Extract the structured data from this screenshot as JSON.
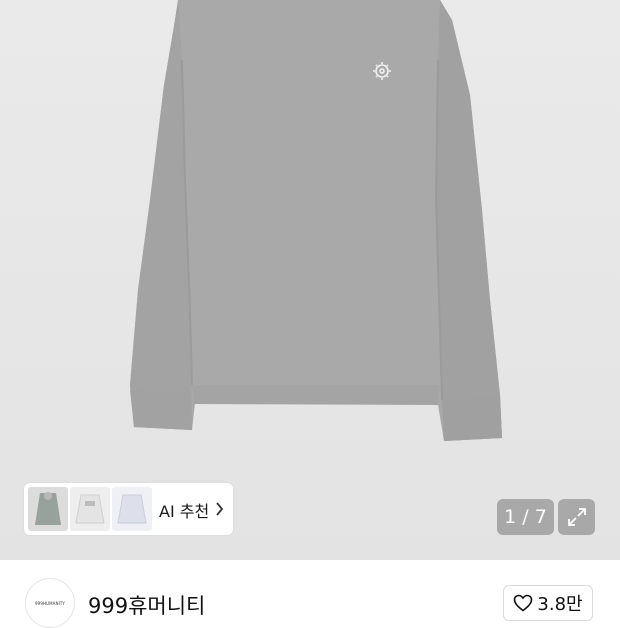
{
  "product_image": {
    "alt_icon": "product-shirt-photo"
  },
  "recommendation": {
    "label": "AI 추천"
  },
  "gallery": {
    "counter": "1 / 7",
    "expand_icon": "expand-icon"
  },
  "seller": {
    "logo_text": "999HUMANITY",
    "name": "999휴머니티"
  },
  "like": {
    "count": "3.8만"
  },
  "colors": {
    "shirt": "#a6a6a6",
    "background": "#e6e6e6",
    "overlay": "#8a8a8a"
  }
}
